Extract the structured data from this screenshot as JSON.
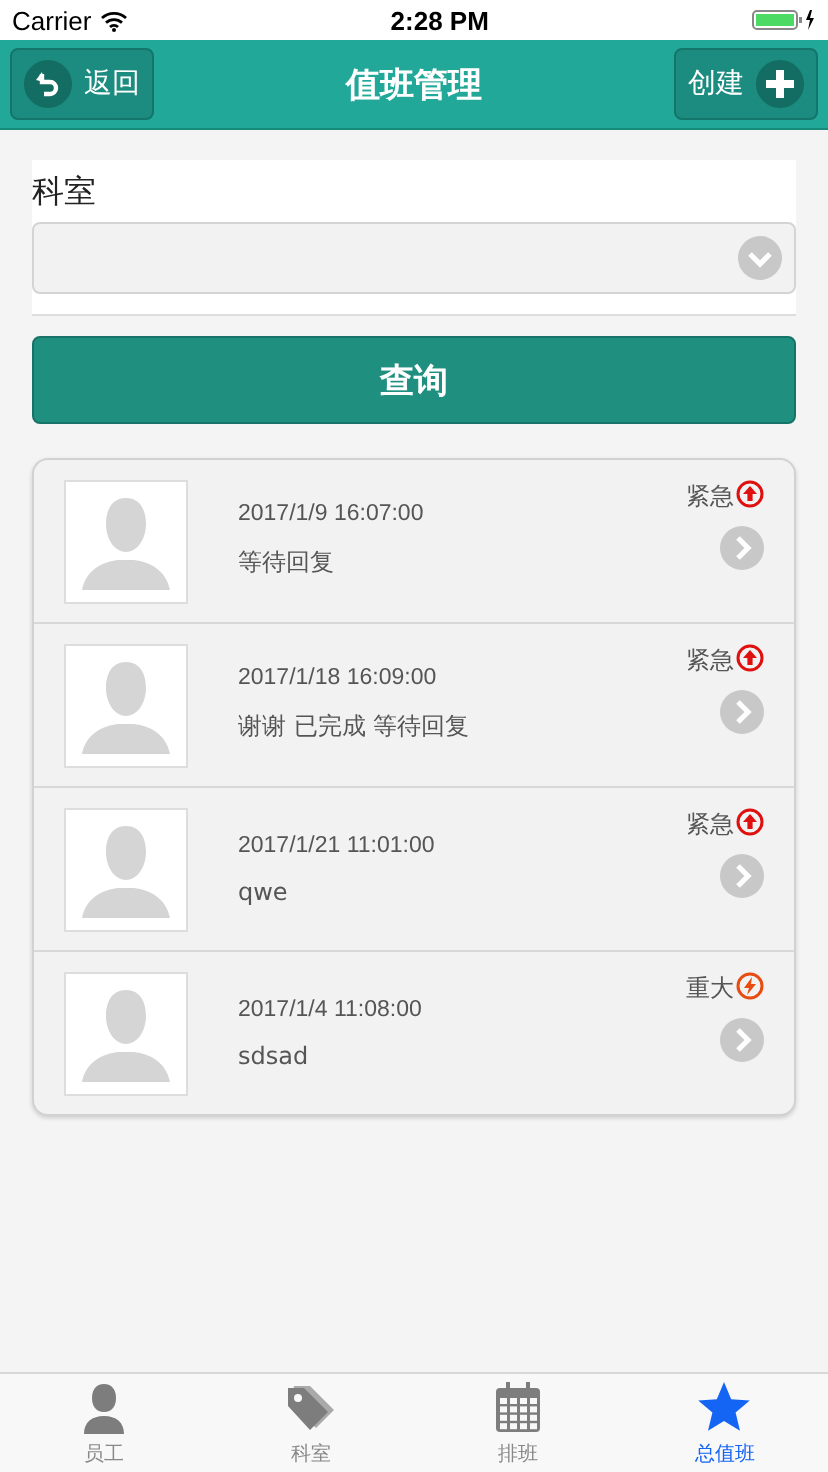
{
  "status_bar": {
    "carrier": "Carrier",
    "time": "2:28 PM"
  },
  "nav": {
    "back": "返回",
    "title": "值班管理",
    "create": "创建"
  },
  "form": {
    "label": "科室",
    "button": "查询"
  },
  "items": [
    {
      "time": "2017/1/9 16:07:00",
      "text": "等待回复",
      "priority": "紧急",
      "kind": "urgent"
    },
    {
      "time": "2017/1/18 16:09:00",
      "text": "谢谢 已完成 等待回复",
      "priority": "紧急",
      "kind": "urgent"
    },
    {
      "time": "2017/1/21 11:01:00",
      "text": "qwe",
      "priority": "紧急",
      "kind": "urgent"
    },
    {
      "time": "2017/1/4 11:08:00",
      "text": "sdsad",
      "priority": "重大",
      "kind": "major"
    }
  ],
  "tabs": [
    {
      "label": "员工",
      "kind": "person",
      "selected": false
    },
    {
      "label": "科室",
      "kind": "tag",
      "selected": false
    },
    {
      "label": "排班",
      "kind": "calendar",
      "selected": false
    },
    {
      "label": "总值班",
      "kind": "star",
      "selected": true
    }
  ]
}
